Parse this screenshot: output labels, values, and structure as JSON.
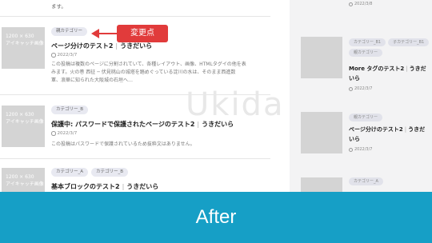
{
  "top_snippet": "ます。",
  "posts": [
    {
      "thumb_lines": [
        "1200 × 630",
        "アイキャッチ画像"
      ],
      "tags": [
        "親カテゴリー"
      ],
      "title": "ページ分けのテスト2",
      "author": "うきだいら",
      "date": "2022/3/7",
      "excerpt": [
        "この投稿は複数のページに分割されていて、各種レイアウト、画像、HTMLタグイの他を表",
        "みます。火の巻 西征 ─ 伏見桃山の城塔を踏めぐっている淀川の水は、そのまま西進数",
        "軍、浪華に知られた大阪城の石垣へ…"
      ]
    },
    {
      "thumb_lines": [
        "1200 × 630",
        "アイキャッチ画像"
      ],
      "tags": [
        "カテゴリー_B"
      ],
      "title": "保護中: パスワードで保護されたページのテスト2",
      "author": "うきだいら",
      "date": "2022/3/7",
      "excerpt": [
        "この投稿はパスワードで保護されているため抜粋文はありません。"
      ]
    },
    {
      "thumb_lines": [
        "1200 × 630",
        "アイキャッチ画像"
      ],
      "tags": [
        "カテゴリー_A",
        "カテゴリー_B"
      ],
      "title": "基本ブロックのテスト2",
      "author": "うきだいら",
      "date": "",
      "excerpt": []
    }
  ],
  "callout": {
    "label": "変更点",
    "color": "#e13b3b"
  },
  "watermark": "Ukida",
  "sidebar": {
    "top_date": "2022/3/8",
    "items": [
      {
        "tags": [
          "カテゴリー_B1",
          "子カテゴリー_B1",
          "親カテゴリー"
        ],
        "title": "More タグのテスト2",
        "author": "うきだいら",
        "date": "2022/3/7"
      },
      {
        "tags": [
          "親カテゴリー"
        ],
        "title": "ページ分けのテスト2",
        "author": "うきだいら",
        "date": "2022/3/7"
      },
      {
        "tags": [
          "カテゴリー_A"
        ],
        "title": "",
        "author": "",
        "date": ""
      }
    ]
  },
  "footer": {
    "label": "After",
    "color": "#169fc6"
  }
}
